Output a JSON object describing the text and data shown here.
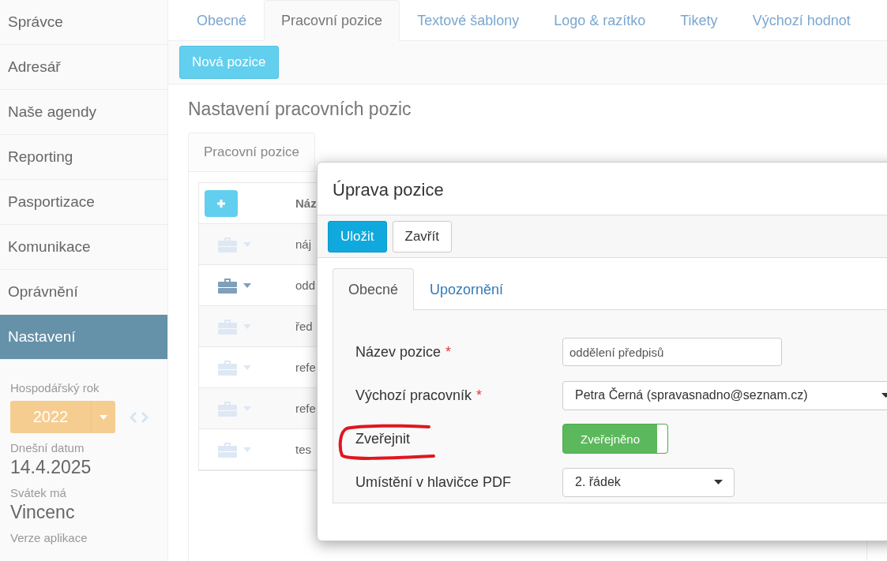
{
  "sidebar": {
    "items": [
      {
        "label": "Správce",
        "selected": false
      },
      {
        "label": "Adresář",
        "selected": false
      },
      {
        "label": "Naše agendy",
        "selected": false
      },
      {
        "label": "Reporting",
        "selected": false
      },
      {
        "label": "Pasportizace",
        "selected": false
      },
      {
        "label": "Komunikace",
        "selected": false
      },
      {
        "label": "Oprávnění",
        "selected": false
      },
      {
        "label": "Nastavení",
        "selected": true
      }
    ],
    "fiscal_year": {
      "label": "Hospodářský rok",
      "value": "2022"
    },
    "today": {
      "label": "Dnešní datum",
      "value": "14.4.2025"
    },
    "name_day": {
      "label": "Svátek má",
      "value": "Vincenc"
    },
    "app_version": {
      "label": "Verze aplikace"
    }
  },
  "tabs": [
    {
      "label": "Obecné",
      "selected": false
    },
    {
      "label": "Pracovní pozice",
      "selected": true
    },
    {
      "label": "Textové šablony",
      "selected": false
    },
    {
      "label": "Logo & razítko",
      "selected": false
    },
    {
      "label": "Tikety",
      "selected": false
    },
    {
      "label": "Výchozí hodnot",
      "selected": false
    }
  ],
  "toolbar": {
    "new_button": "Nová pozice"
  },
  "heading": "Nastavení pracovních pozic",
  "panel": {
    "tab": "Pracovní pozice",
    "table": {
      "columns": [
        "Náz"
      ],
      "rows": [
        {
          "name": "náj",
          "active": false
        },
        {
          "name": "odd",
          "active": true
        },
        {
          "name": "řed",
          "active": false
        },
        {
          "name": "refe",
          "active": false
        },
        {
          "name": "refe",
          "active": false
        },
        {
          "name": "tes",
          "active": false
        }
      ]
    }
  },
  "dialog": {
    "title": "Úprava pozice",
    "buttons": [
      {
        "label": "Uložit",
        "kind": "primary"
      },
      {
        "label": "Zavřít",
        "kind": "default"
      }
    ],
    "tabs": [
      {
        "label": "Obecné",
        "selected": true
      },
      {
        "label": "Upozornění",
        "selected": false
      }
    ],
    "fields": [
      {
        "kind": "text",
        "label": "Název pozice",
        "required_mark": "*",
        "value": "oddělení předpisů",
        "highlighted": false
      },
      {
        "kind": "select",
        "label": "Výchozí pracovník",
        "required_mark": "*",
        "value": "Petra Černá (spravasnadno@seznam.cz)",
        "highlighted": false
      },
      {
        "kind": "toggle",
        "label": "Zveřejnit",
        "on": true,
        "value": "Zveřejněno",
        "highlighted": true
      },
      {
        "kind": "select",
        "label": "Umístění v hlavičce PDF",
        "value": "2. řádek",
        "highlighted": false
      }
    ]
  }
}
